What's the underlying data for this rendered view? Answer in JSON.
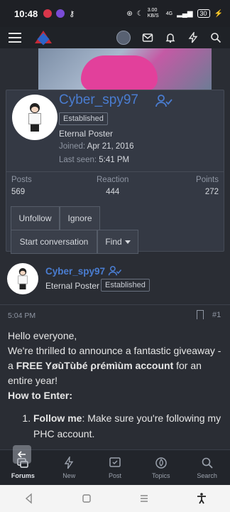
{
  "status_bar": {
    "time": "10:48",
    "network_speed": "3.00 KB/S",
    "signal": "4G",
    "battery": "30"
  },
  "profile_card": {
    "username": "Cyber_spy97",
    "badge": "Established",
    "user_title": "Eternal Poster",
    "joined_label": "Joined:",
    "joined_value": "Apr 21, 2016",
    "last_seen_label": "Last seen:",
    "last_seen_value": "5:41 PM",
    "stats": [
      {
        "label": "Posts",
        "value": "569"
      },
      {
        "label": "Reaction",
        "value": "444"
      },
      {
        "label": "Points",
        "value": "272"
      }
    ],
    "buttons": {
      "unfollow": "Unfollow",
      "ignore": "Ignore",
      "start_conversation": "Start conversation",
      "find": "Find"
    }
  },
  "post": {
    "username": "Cyber_spy97",
    "user_title": "Eternal Poster",
    "badge": "Established",
    "time": "5:04 PM",
    "post_number": "#1",
    "line1": "Hello everyone,",
    "line2_a": "We're thrilled to announce a fantastic giveaway - a ",
    "line2_bold": "FREE YøùTùbé ρrémìùm account",
    "line2_b": " for an entire year!",
    "how_to": "How to Enter:",
    "step1_bold": "Follow me",
    "step1_text": ": Make sure you're following my PHC account."
  },
  "bottom_nav": [
    {
      "label": "Forums",
      "icon": "forums-icon"
    },
    {
      "label": "New",
      "icon": "bolt-icon"
    },
    {
      "label": "Post",
      "icon": "post-icon"
    },
    {
      "label": "Topics",
      "icon": "fire-icon"
    },
    {
      "label": "Search",
      "icon": "search-icon"
    }
  ],
  "colors": {
    "accent": "#4a7dd1",
    "background": "#2a2d34",
    "card": "#343944"
  }
}
